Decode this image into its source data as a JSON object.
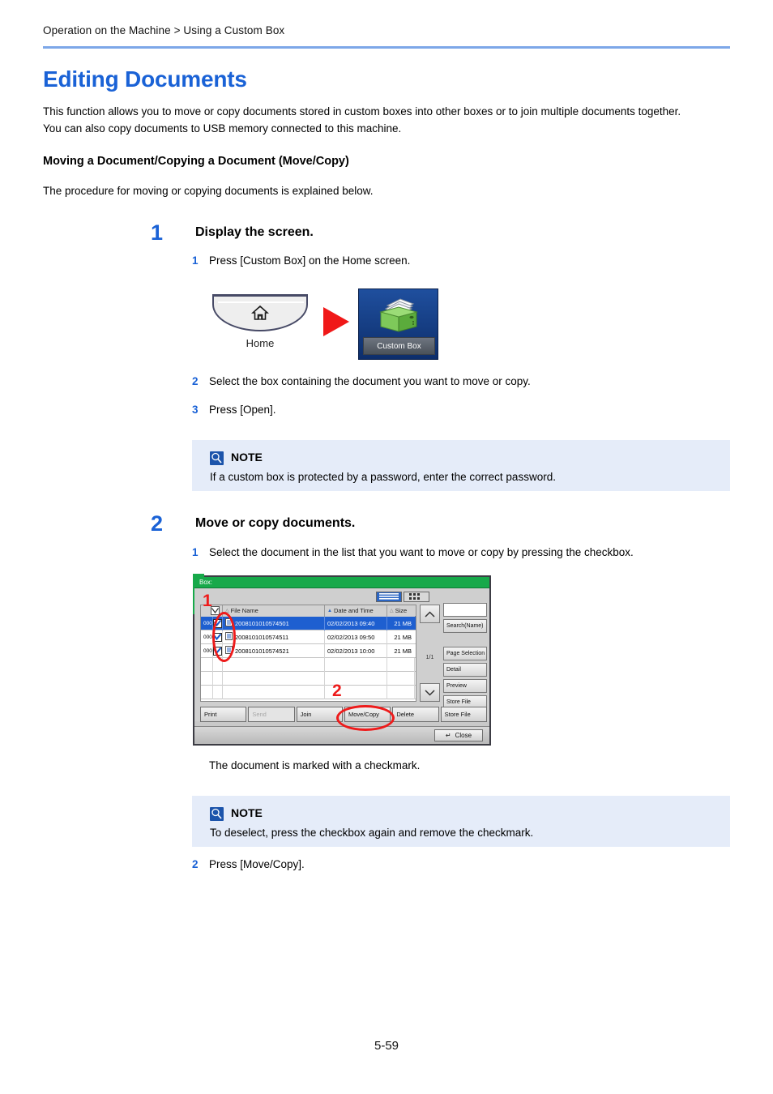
{
  "header": {
    "breadcrumb": "Operation on the Machine > Using a Custom Box"
  },
  "page_title": "Editing Documents",
  "intro": "This function allows you to move or copy documents stored in custom boxes into other boxes or to join multiple documents together. You can also copy documents to USB memory connected to this machine.",
  "section": {
    "heading": "Moving a Document/Copying a Document (Move/Copy)",
    "intro": "The procedure for moving or copying documents is explained below."
  },
  "steps": [
    {
      "num": "1",
      "title": "Display the screen.",
      "substeps": [
        {
          "num": "1",
          "text": "Press [Custom Box] on the Home screen."
        },
        {
          "num": "2",
          "text": "Select the box containing the document you want to move or copy."
        },
        {
          "num": "3",
          "text": "Press [Open]."
        }
      ]
    },
    {
      "num": "2",
      "title": "Move or copy documents.",
      "substeps": [
        {
          "num": "1",
          "text": "Select the document in the list that you want to move or copy by pressing the checkbox."
        },
        {
          "num": "2",
          "text": "Press [Move/Copy]."
        }
      ]
    }
  ],
  "notes": [
    {
      "label": "NOTE",
      "text": "If a custom box is protected by a password, enter the correct password."
    },
    {
      "label": "NOTE",
      "text": "To deselect, press the checkbox again and remove the checkmark."
    }
  ],
  "figure_home": {
    "home_key_label": "Home",
    "custom_box_label": "Custom Box"
  },
  "caption": "The document is marked with a checkmark.",
  "panel": {
    "title_bar": "Box:",
    "columns": {
      "file_name": "File Name",
      "date_and_time": "Date and Time",
      "size": "Size"
    },
    "rows": [
      {
        "id": "000",
        "name": "2008101010574501",
        "date": "02/02/2013 09:40",
        "size": "21  MB",
        "checked": true,
        "selected": true
      },
      {
        "id": "000",
        "name": "2008101010574511",
        "date": "02/02/2013 09:50",
        "size": "21  MB",
        "checked": true,
        "selected": false
      },
      {
        "id": "000",
        "name": "2008101010574521",
        "date": "02/02/2013 10:00",
        "size": "21  MB",
        "checked": true,
        "selected": false
      }
    ],
    "page_indicator": "1/1",
    "search_field_value": "",
    "right_buttons": [
      "Search(Name)",
      "Page Selection",
      "Detail",
      "Preview",
      "Store File"
    ],
    "function_buttons": [
      {
        "label": "Print",
        "disabled": false
      },
      {
        "label": "Send",
        "disabled": true
      },
      {
        "label": "Join",
        "disabled": false
      },
      {
        "label": "Move/Copy",
        "disabled": false
      },
      {
        "label": "Delete",
        "disabled": false
      },
      {
        "label": "Store File",
        "disabled": false
      }
    ],
    "close_label": "Close",
    "annotations": [
      {
        "label": "1"
      },
      {
        "label": "2"
      }
    ]
  },
  "footer": {
    "page_number": "5-59"
  },
  "colors": {
    "accent_blue": "#1a62d6",
    "rule_blue": "#7da7e8",
    "note_bg": "#e5ecf9",
    "annotation_red": "#ee1b1b",
    "panel_green": "#17a94a",
    "row_selected": "#1e5fd0"
  }
}
